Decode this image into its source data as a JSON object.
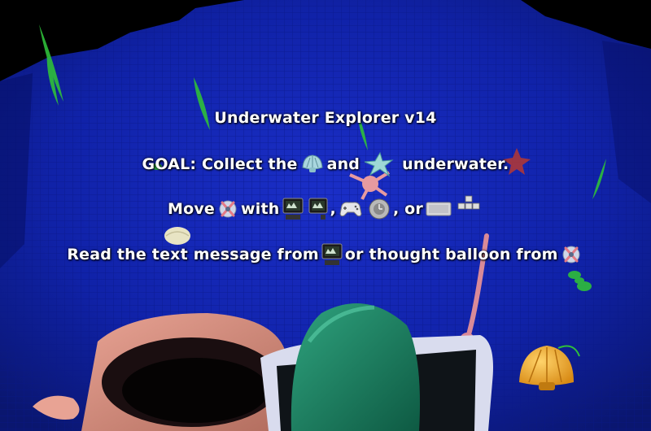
{
  "overlay": {
    "title": "Underwater Explorer v14",
    "goal": {
      "prefix": "GOAL: Collect the",
      "and": "and",
      "suffix": "underwater."
    },
    "move": {
      "prefix": "Move",
      "with": "with",
      "comma1": ",",
      "comma2": ", or"
    },
    "read": {
      "prefix": "Read the text message from",
      "middle": "or thought balloon from"
    }
  },
  "icons": {
    "goal_item_1": "clam-shell-icon",
    "goal_item_2": "starfish-icon",
    "character": "robot-character-icon",
    "device_1": "camera-device-icon",
    "device_2": "tablet-device-icon",
    "controller": "gamepad-icon",
    "joystick": "joystick-icon",
    "keyboard": "keyboard-icon",
    "arrow_keys": "arrow-keys-icon"
  },
  "colors": {
    "water": "#0f1fa3",
    "water_dark": "#07106b",
    "seaweed": "#2fbf3a",
    "text": "#ffffff"
  }
}
